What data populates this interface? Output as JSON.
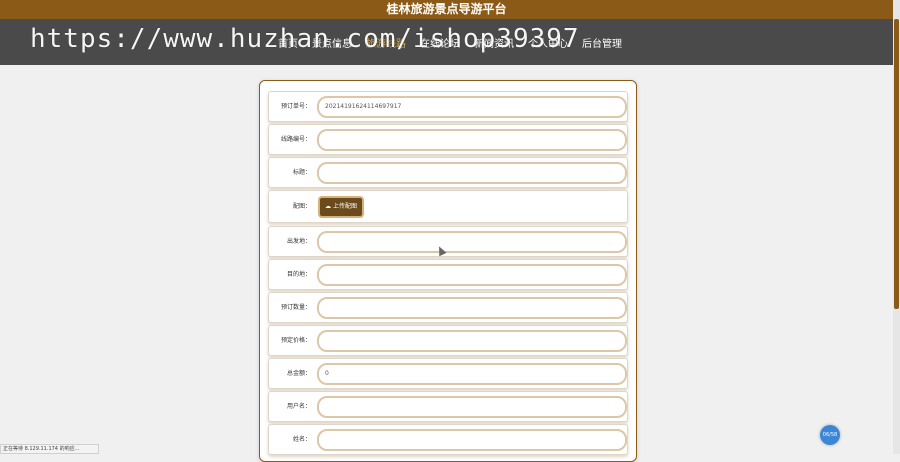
{
  "header": {
    "title": "桂林旅游景点导游平台"
  },
  "nav": {
    "items": [
      {
        "label": "首页"
      },
      {
        "label": "景点信息"
      },
      {
        "label": "旅游线路"
      },
      {
        "label": "在线论坛"
      },
      {
        "label": "新闻资讯"
      },
      {
        "label": "个人中心"
      },
      {
        "label": "后台管理"
      }
    ],
    "active_index": 2
  },
  "watermark": "https://www.huzhan.com/ishop39397",
  "form": {
    "rows": [
      {
        "label": "预订单号：",
        "value": "20214191624114697917"
      },
      {
        "label": "线路编号：",
        "value": ""
      },
      {
        "label": "标题：",
        "value": ""
      },
      {
        "label": "配图：",
        "button": "上传配图"
      },
      {
        "label": "出发地：",
        "value": ""
      },
      {
        "label": "目的地：",
        "value": ""
      },
      {
        "label": "预订数量：",
        "value": ""
      },
      {
        "label": "预定价格：",
        "value": ""
      },
      {
        "label": "总金额：",
        "value": "0"
      },
      {
        "label": "用户名：",
        "value": ""
      },
      {
        "label": "姓名：",
        "value": ""
      }
    ]
  },
  "status_bar": "正在等待 8.129.11.174 的响应...",
  "float_button": "06/58",
  "colors": {
    "brand": "#8b5a16",
    "nav_bg": "#4a4a4a",
    "active_nav": "#d4a64a"
  }
}
